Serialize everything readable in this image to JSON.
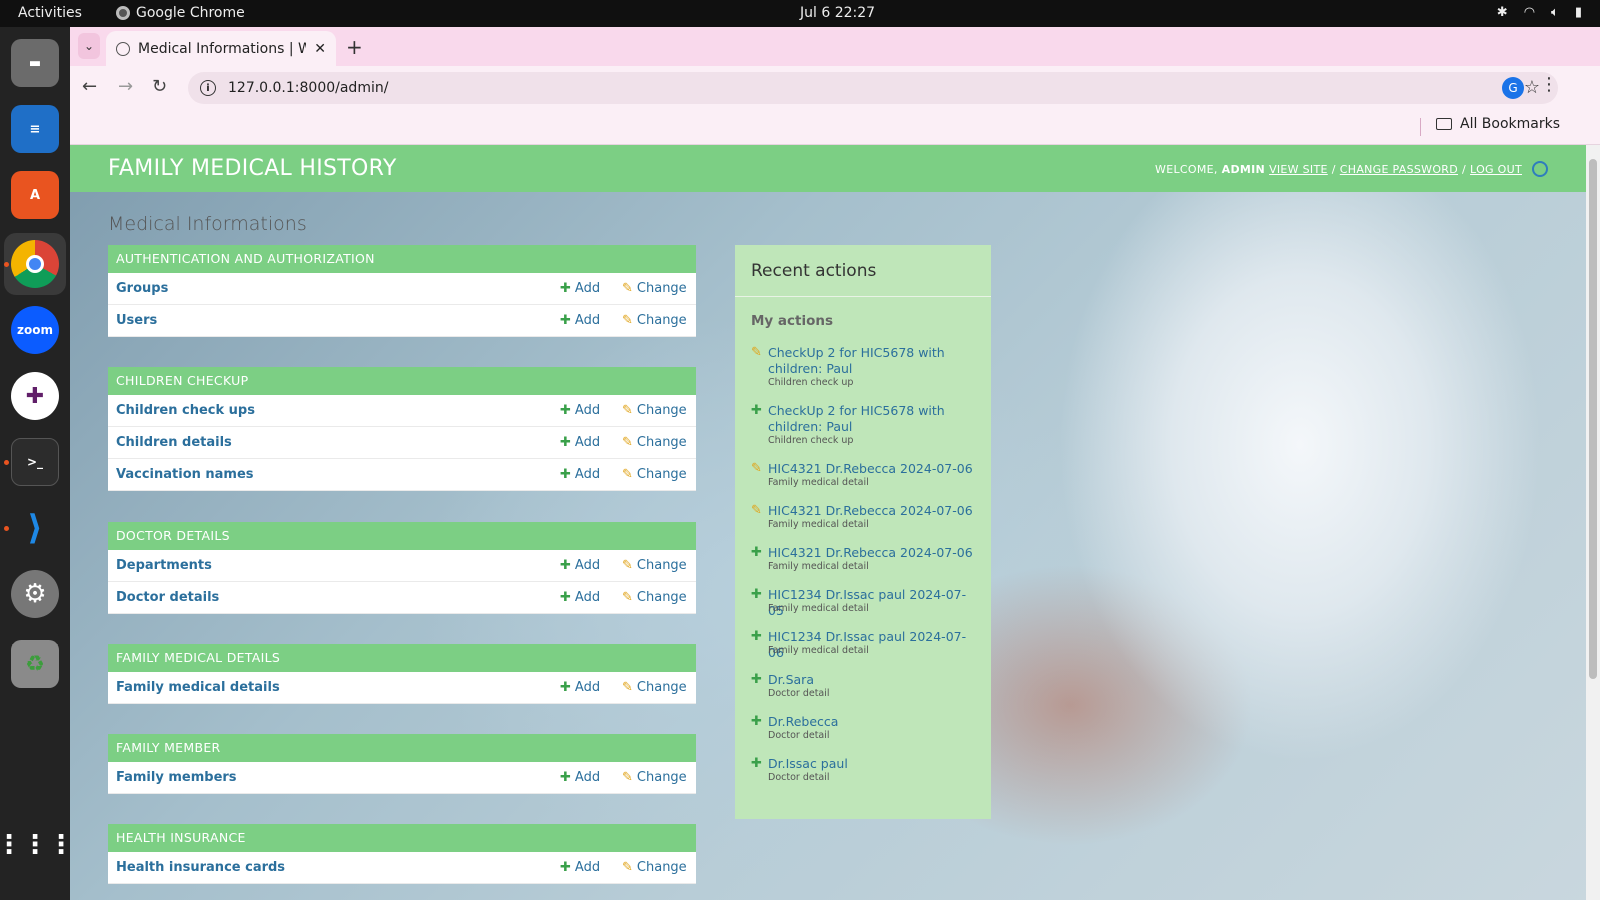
{
  "topbar": {
    "activities": "Activities",
    "app": "Google Chrome",
    "clock": "Jul 6  22:27"
  },
  "browser": {
    "tab_title": "Medical Informations | W",
    "url": "127.0.0.1:8000/admin/",
    "profile_initial": "G",
    "bookmarks_label": "All Bookmarks"
  },
  "site": {
    "brand": "FAMILY MEDICAL HISTORY",
    "welcome": "WELCOME,",
    "user": "ADMIN",
    "view_site": "VIEW SITE",
    "change_password": "CHANGE PASSWORD",
    "log_out": "LOG OUT",
    "page_title": "Medical Informations"
  },
  "labels": {
    "add": "Add",
    "change": "Change"
  },
  "modules": [
    {
      "caption": "AUTHENTICATION AND AUTHORIZATION",
      "models": [
        "Groups",
        "Users"
      ]
    },
    {
      "caption": "CHILDREN CHECKUP",
      "models": [
        "Children check ups",
        "Children details",
        "Vaccination names"
      ]
    },
    {
      "caption": "DOCTOR DETAILS",
      "models": [
        "Departments",
        "Doctor details"
      ]
    },
    {
      "caption": "FAMILY MEDICAL DETAILS",
      "models": [
        "Family medical details"
      ]
    },
    {
      "caption": "FAMILY MEMBER",
      "models": [
        "Family members"
      ]
    },
    {
      "caption": "HEALTH INSURANCE",
      "models": [
        "Health insurance cards"
      ]
    }
  ],
  "recent": {
    "heading": "Recent actions",
    "subheading": "My actions",
    "actions": [
      {
        "kind": "change",
        "text": "CheckUp 2 for HIC5678 with children: Paul",
        "type": "Children check up"
      },
      {
        "kind": "add",
        "text": "CheckUp 2 for HIC5678 with children: Paul",
        "type": "Children check up"
      },
      {
        "kind": "change",
        "text": "HIC4321 Dr.Rebecca 2024-07-06",
        "type": "Family medical detail"
      },
      {
        "kind": "change",
        "text": "HIC4321 Dr.Rebecca 2024-07-06",
        "type": "Family medical detail"
      },
      {
        "kind": "add",
        "text": "HIC4321 Dr.Rebecca 2024-07-06",
        "type": "Family medical detail"
      },
      {
        "kind": "add",
        "text": "HIC1234 Dr.Issac paul 2024-07-05",
        "type": "Family medical detail"
      },
      {
        "kind": "add",
        "text": "HIC1234 Dr.Issac paul 2024-07-06",
        "type": "Family medical detail"
      },
      {
        "kind": "add",
        "text": "Dr.Sara",
        "type": "Doctor detail"
      },
      {
        "kind": "add",
        "text": "Dr.Rebecca",
        "type": "Doctor detail"
      },
      {
        "kind": "add",
        "text": "Dr.Issac paul",
        "type": "Doctor detail"
      }
    ]
  }
}
